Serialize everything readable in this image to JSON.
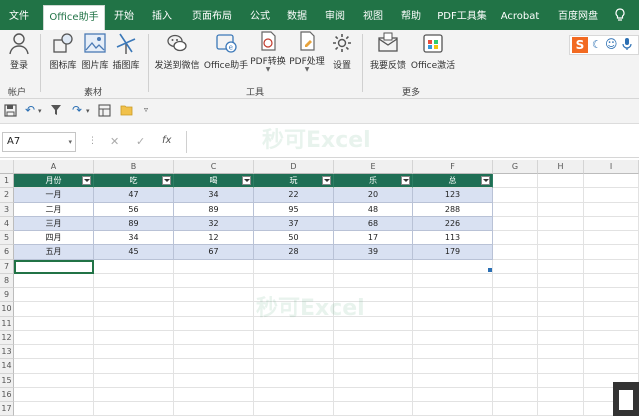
{
  "tabs": [
    "文件",
    "Office助手",
    "开始",
    "插入",
    "页面布局",
    "公式",
    "数据",
    "审阅",
    "视图",
    "帮助",
    "PDF工具集",
    "Acrobat",
    "百度网盘"
  ],
  "active_tab": "Office助手",
  "status_icons": [
    "sogou-s-icon",
    "moon-icon",
    "face-icon",
    "microphone-icon"
  ],
  "ribbon": {
    "account_button": "登录",
    "material_buttons": [
      "图标库",
      "图片库",
      "插图库"
    ],
    "tool_buttons": [
      "发送到微信",
      "Office助手",
      "PDF转换",
      "PDF处理",
      "设置"
    ],
    "more_buttons": [
      "我要反馈",
      "Office激活"
    ],
    "groups": [
      "帐户",
      "素材",
      "工具",
      "更多"
    ]
  },
  "formula_bar": {
    "name_box": "A7",
    "fx": "fx",
    "cancel": "✕",
    "confirm": "✓"
  },
  "sheet": {
    "columns": [
      "A",
      "B",
      "C",
      "D",
      "E",
      "F",
      "G",
      "H",
      "I"
    ],
    "row_numbers": [
      "1",
      "2",
      "3",
      "4",
      "5",
      "6",
      "7",
      "8",
      "9",
      "10",
      "11",
      "12",
      "13",
      "14",
      "15",
      "16",
      "17"
    ],
    "table_headers": [
      "月份",
      "吃",
      "喝",
      "玩",
      "乐",
      "总"
    ],
    "table_rows": [
      [
        "一月",
        "47",
        "34",
        "22",
        "20",
        "123"
      ],
      [
        "二月",
        "56",
        "89",
        "95",
        "48",
        "288"
      ],
      [
        "三月",
        "89",
        "32",
        "37",
        "68",
        "226"
      ],
      [
        "四月",
        "34",
        "12",
        "50",
        "17",
        "113"
      ],
      [
        "五月",
        "45",
        "67",
        "28",
        "39",
        "179"
      ]
    ]
  },
  "watermark": "秒可Excel",
  "colors": {
    "accent": "#217346",
    "table_header": "#1f6f55",
    "band": "#d9e1f2"
  }
}
